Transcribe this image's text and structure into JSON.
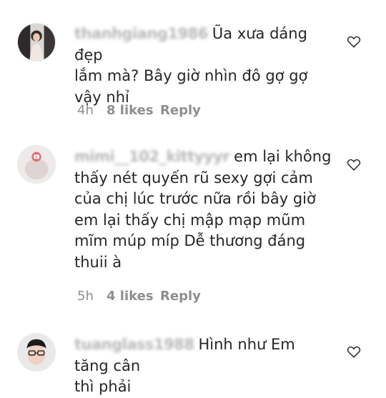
{
  "comments": [
    {
      "username": "thanhgiang1986",
      "text": "Ũa xưa dáng đẹp\nlắm mà? Bây giờ nhìn đô gợ gợ\nvậy nhỉ",
      "time": "4h",
      "likes": "8 likes",
      "reply": "Reply"
    },
    {
      "username": "mimi__102_kittyyyr",
      "text": "em lại không\nthấy nét quyến rũ sexy gợi cảm\ncủa chị lúc trước nữa rồi bây giờ\nem lại thấy chị mập mạp mũm\nmĩm múp míp Dễ thương đáng\nthuii à",
      "time": "5h",
      "likes": "4 likes",
      "reply": "Reply"
    },
    {
      "username": "tuanglass1988",
      "text": "Hình như Em tăng cân\nthì phải",
      "time": "",
      "likes": "",
      "reply": ""
    }
  ],
  "colors": {
    "text": "#262626",
    "meta": "#8e8e8e",
    "heart_stroke": "#262626"
  },
  "icons": {
    "like": "heart-outline-icon"
  }
}
